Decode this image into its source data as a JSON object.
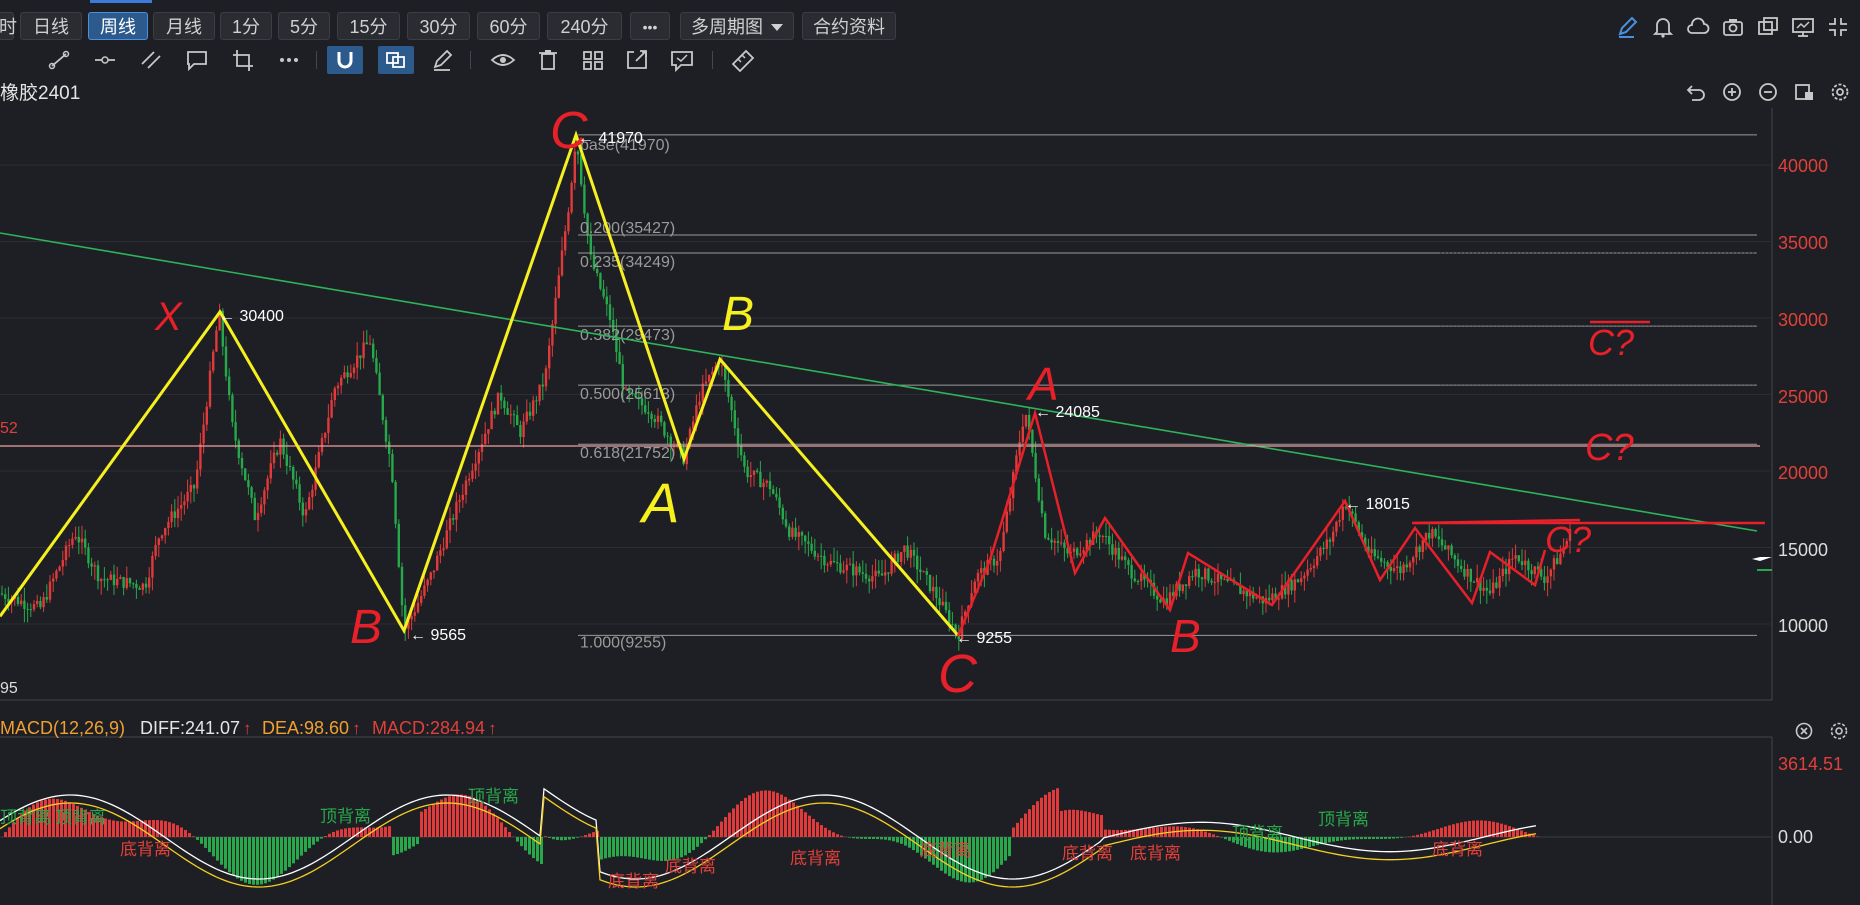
{
  "toolbar": {
    "periods": [
      "日线",
      "周线",
      "月线",
      "1分",
      "5分",
      "15分",
      "30分",
      "60分",
      "240分"
    ],
    "active_period": "周线",
    "more_label": "•••",
    "multi_period_label": "多周期图",
    "contract_label": "合约资料",
    "left_cut_label": "时"
  },
  "symbol": "橡胶2401",
  "colors": {
    "bg": "#1e1f24",
    "up": "#e03a3a",
    "down": "#27a84a",
    "accent": "#4a8fe0",
    "axis_text": "#e0403a",
    "annotation_yellow": "#f5f01e",
    "annotation_red": "#e8202a",
    "trendline": "#2fb35a"
  },
  "price_axis": {
    "ticks": [
      "40000",
      "35000",
      "30000",
      "25000",
      "20000",
      "15000",
      "10000"
    ]
  },
  "price_labels": {
    "p41970": "41970",
    "p30400": "30400",
    "p9565": "9565",
    "p9255": "9255",
    "p24085": "24085",
    "p18015": "18015",
    "left_52": "52",
    "left_95": "95"
  },
  "fib_levels": [
    {
      "label": "base(41970)",
      "value": 41970
    },
    {
      "label": "0.200(35427)",
      "value": 35427
    },
    {
      "label": "0.235(34249)",
      "value": 34249
    },
    {
      "label": "0.382(29473)",
      "value": 29473
    },
    {
      "label": "0.500(25613)",
      "value": 25613
    },
    {
      "label": "0.618(21752)",
      "value": 21752
    },
    {
      "label": "1.000(9255)",
      "value": 9255
    }
  ],
  "annotations": {
    "yellow": [
      "X",
      "B",
      "A",
      "B"
    ],
    "red": [
      "C",
      "C",
      "A",
      "B",
      "C?",
      "C?",
      "C?"
    ]
  },
  "macd": {
    "title": "MACD(12,26,9)",
    "diff": "DIFF:241.07",
    "dea": "DEA:98.60",
    "macd": "MACD:284.94",
    "arrow": "↑",
    "axis_top": "3614.51",
    "axis_zero": "0.00",
    "labels_top": [
      "顶背离",
      "顶背离",
      "顶背离",
      "顶背离",
      "顶背离",
      "顶背离"
    ],
    "labels_bottom": [
      "底背离",
      "底背离",
      "底背离",
      "底背离",
      "底背离",
      "底背离",
      "底背离",
      "底背离"
    ]
  },
  "chart_data": {
    "type": "candlestick",
    "title": "橡胶2401",
    "period": "周线",
    "ylim": [
      7500,
      43000
    ],
    "key_points": [
      {
        "label": "30400",
        "value": 30400
      },
      {
        "label": "9565",
        "value": 9565
      },
      {
        "label": "41970",
        "value": 41970
      },
      {
        "label": "9255",
        "value": 9255
      },
      {
        "label": "24085",
        "value": 24085
      },
      {
        "label": "18015",
        "value": 18015
      }
    ],
    "horizontal_lines": [
      21752,
      16400
    ],
    "wave_points_yellow": [
      {
        "t": 0,
        "v": 10500
      },
      {
        "t": 220,
        "v": 30400
      },
      {
        "t": 404,
        "v": 9565
      },
      {
        "t": 576,
        "v": 41970
      },
      {
        "t": 684,
        "v": 20800
      },
      {
        "t": 720,
        "v": 27300
      },
      {
        "t": 958,
        "v": 9255
      }
    ],
    "macd_axis": {
      "top": 3614.51,
      "zero": 0.0
    }
  }
}
